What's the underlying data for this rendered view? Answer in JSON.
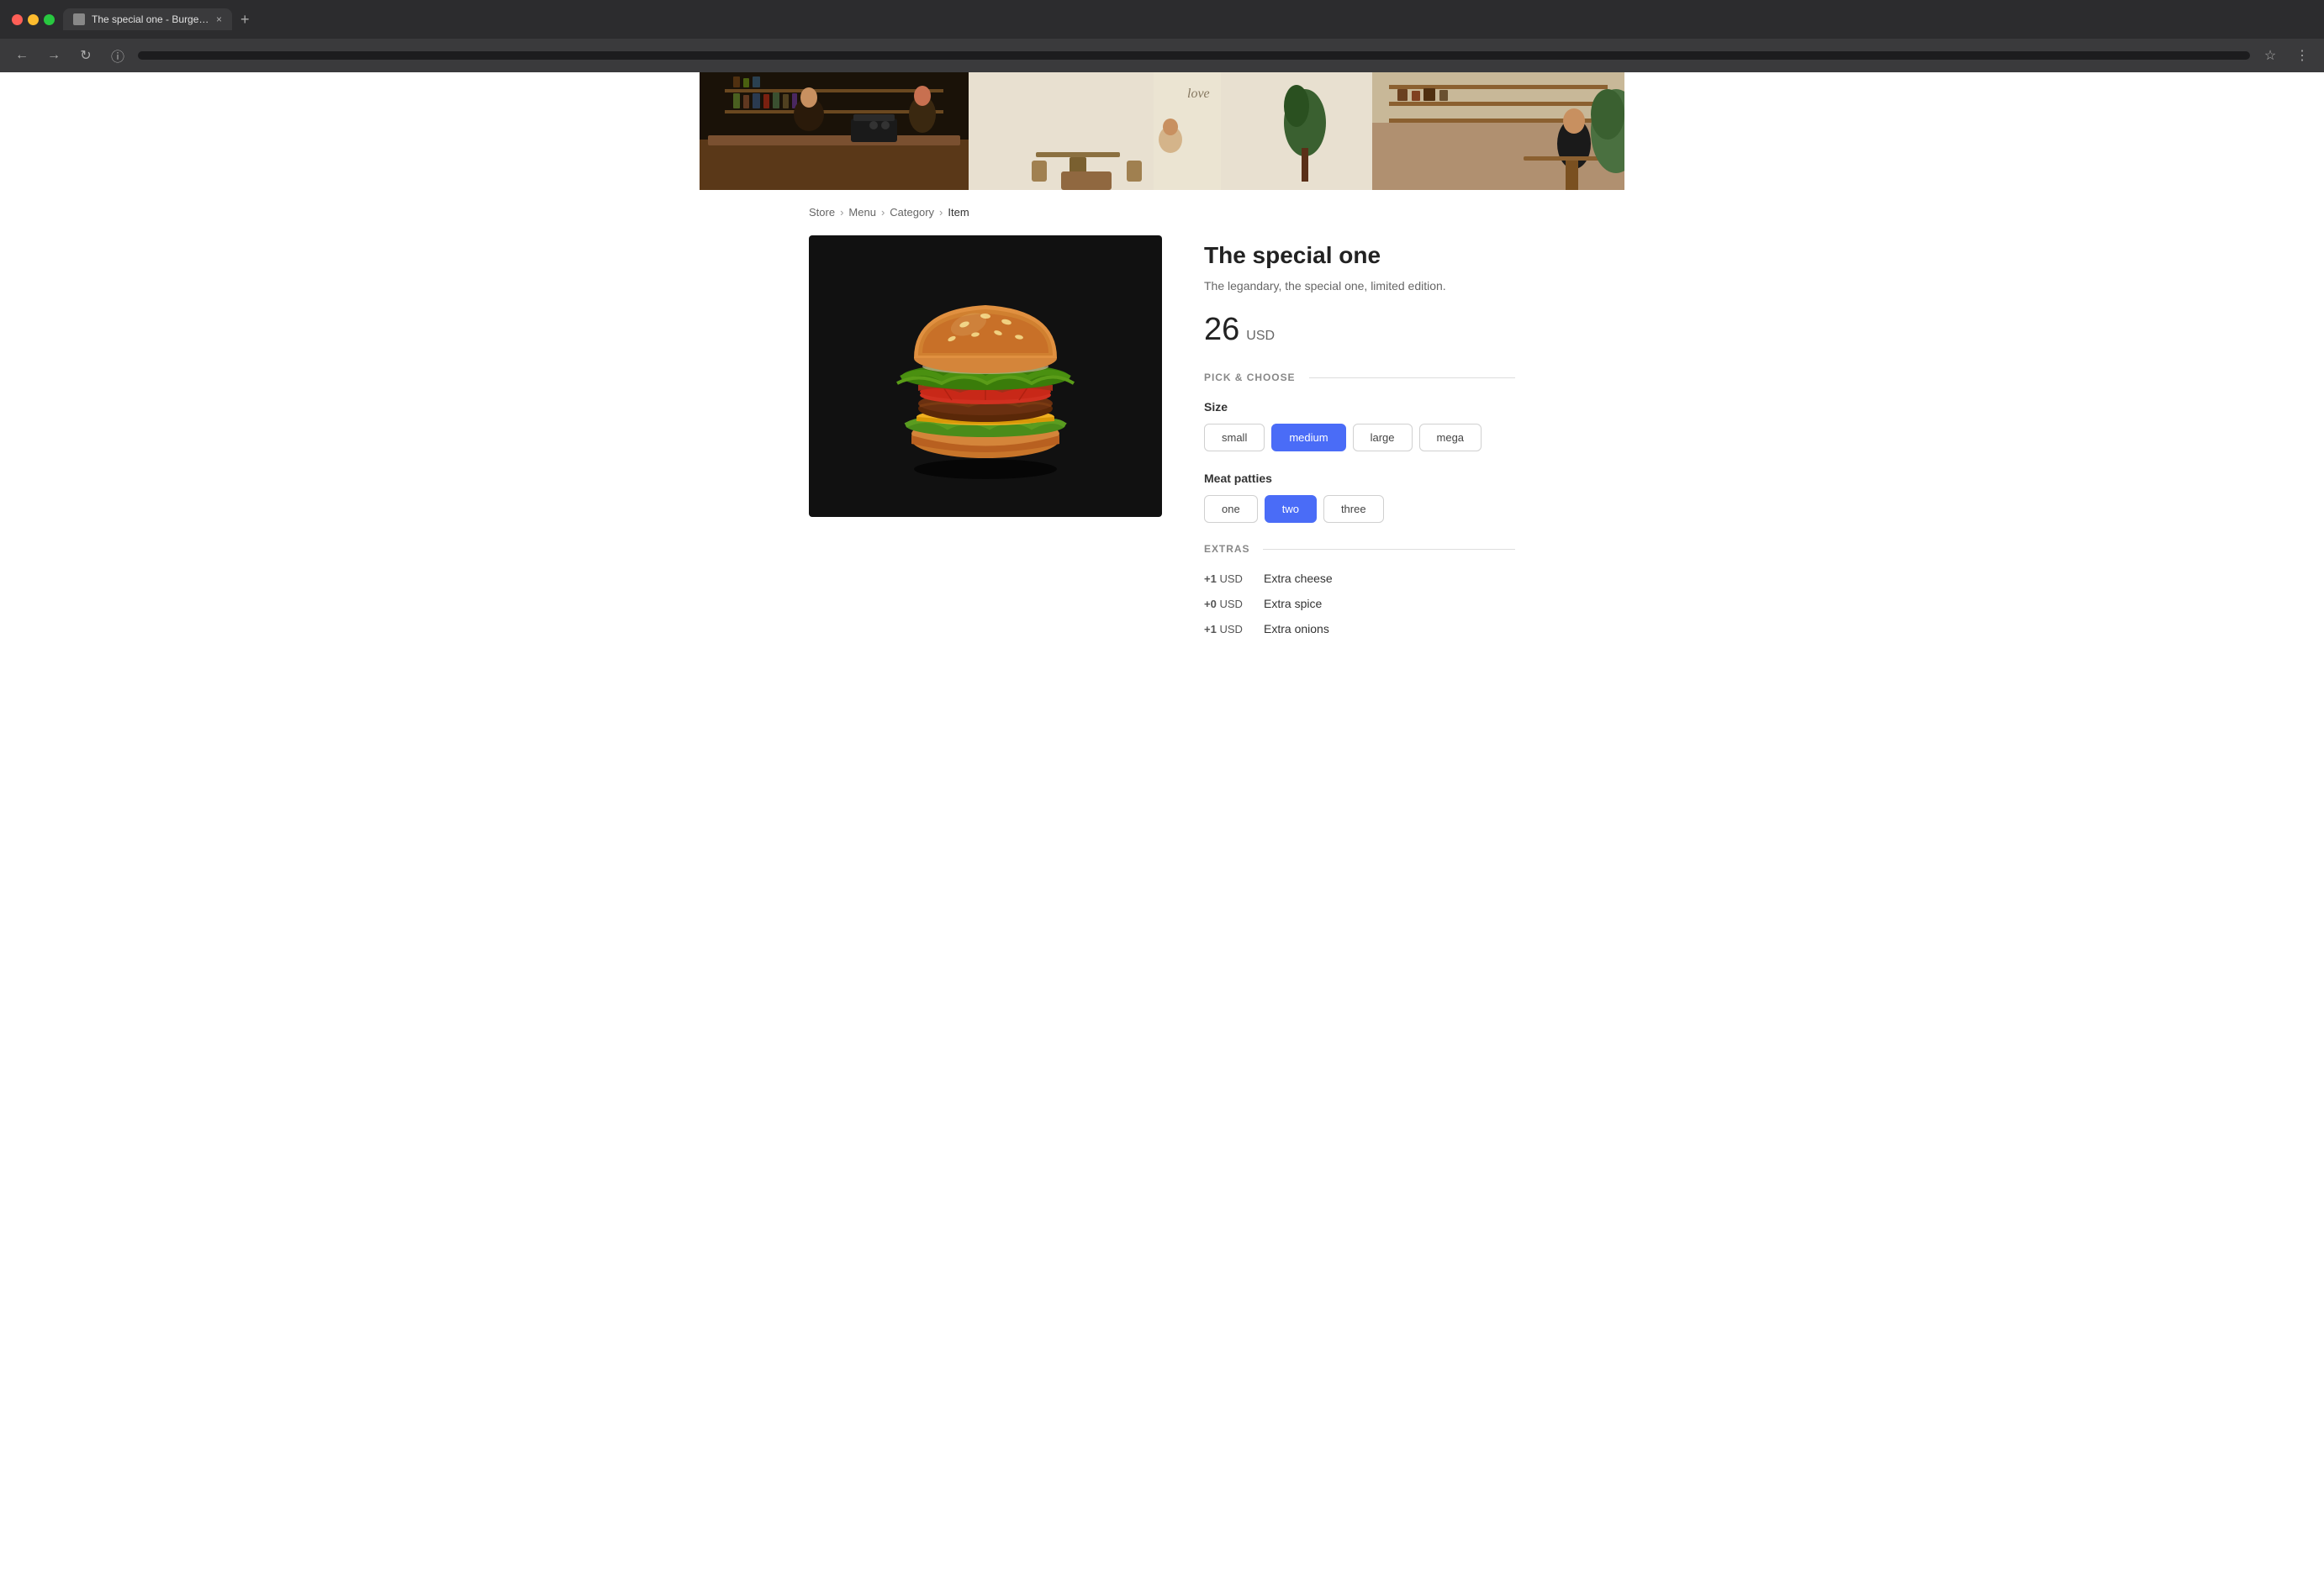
{
  "browser": {
    "tab_title": "The special one - Burgers - Lu",
    "tab_close": "×",
    "tab_new": "+",
    "back_icon": "←",
    "forward_icon": "→",
    "reload_icon": "↻",
    "info_icon": "ⓘ",
    "bookmark_icon": "☆",
    "menu_icon": "⋮"
  },
  "breadcrumb": {
    "store": "Store",
    "menu": "Menu",
    "category": "Category",
    "item": "Item",
    "sep": "›"
  },
  "product": {
    "title": "The special one",
    "description": "The legandary, the special one, limited edition.",
    "price": "26",
    "currency": "USD"
  },
  "pick_choose": {
    "label": "PICK & CHOOSE",
    "size": {
      "label": "Size",
      "options": [
        "small",
        "medium",
        "large",
        "mega"
      ],
      "selected": "medium"
    },
    "meat_patties": {
      "label": "Meat patties",
      "options": [
        "one",
        "two",
        "three"
      ],
      "selected": "two"
    }
  },
  "extras": {
    "label": "EXTRAS",
    "items": [
      {
        "price": "+1 USD",
        "name": "Extra cheese"
      },
      {
        "price": "+0 USD",
        "name": "Extra spice"
      },
      {
        "price": "+1 USD",
        "name": "Extra onions"
      }
    ]
  }
}
